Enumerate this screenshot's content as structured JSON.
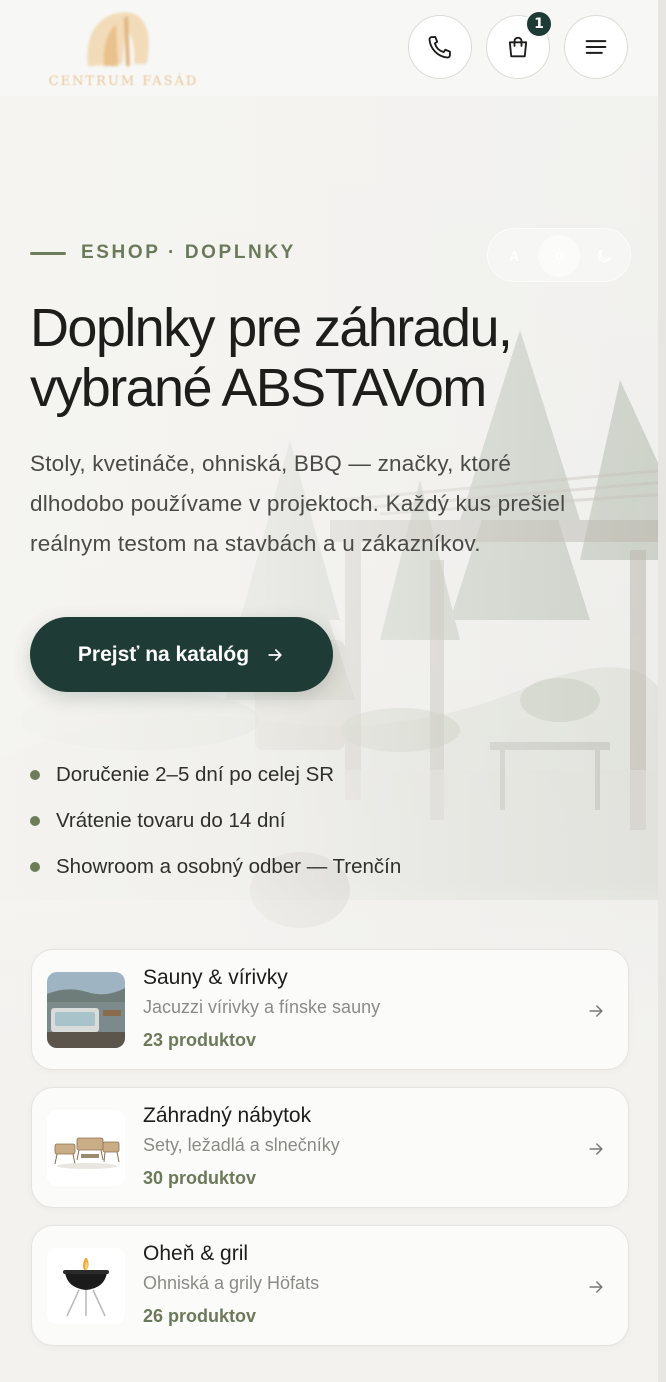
{
  "colors": {
    "accent": "#1f3b35",
    "olive": "#6b7a5a",
    "logo_gold": "#e9c79a"
  },
  "header": {
    "logo_text": "CENTRUM FASÁD",
    "phone_icon": "phone-icon",
    "cart_icon": "shopping-bag-icon",
    "cart_count": "1",
    "menu_icon": "hamburger-menu-icon"
  },
  "hero": {
    "eyebrow": "ESHOP · DOPLNKY",
    "theme_options": [
      "A",
      "sun-icon",
      "moon-icon"
    ],
    "title_line1": "Doplnky pre záhradu,",
    "title_line2": "vybrané ABSTAVom",
    "desc_line1": "Stoly, kvetináče, ohniská, BBQ — značky, ktoré",
    "desc_line2": "dlhodobo používame v projektoch. Každý kus prešiel",
    "desc_line3": "reálnym testom na stavbách a u zákazníkov.",
    "cta_label": "Prejsť na katalóg"
  },
  "features": [
    "Doručenie 2–5 dní po celej SR",
    "Vrátenie tovaru do 14 dní",
    "Showroom a osobný odber — Trenčín"
  ],
  "categories": [
    {
      "name": "Sauny & vírivky",
      "sub": "Jacuzzi vírivky a fínske sauny",
      "count": "23 produktov",
      "image": "sauna-jacuzzi-thumbnail"
    },
    {
      "name": "Záhradný nábytok",
      "sub": "Sety, ležadlá a slnečníky",
      "count": "30 produktov",
      "image": "garden-furniture-thumbnail"
    },
    {
      "name": "Oheň & gril",
      "sub": "Ohniská a grily Höfats",
      "count": "26 produktov",
      "image": "fire-bowl-thumbnail"
    }
  ]
}
